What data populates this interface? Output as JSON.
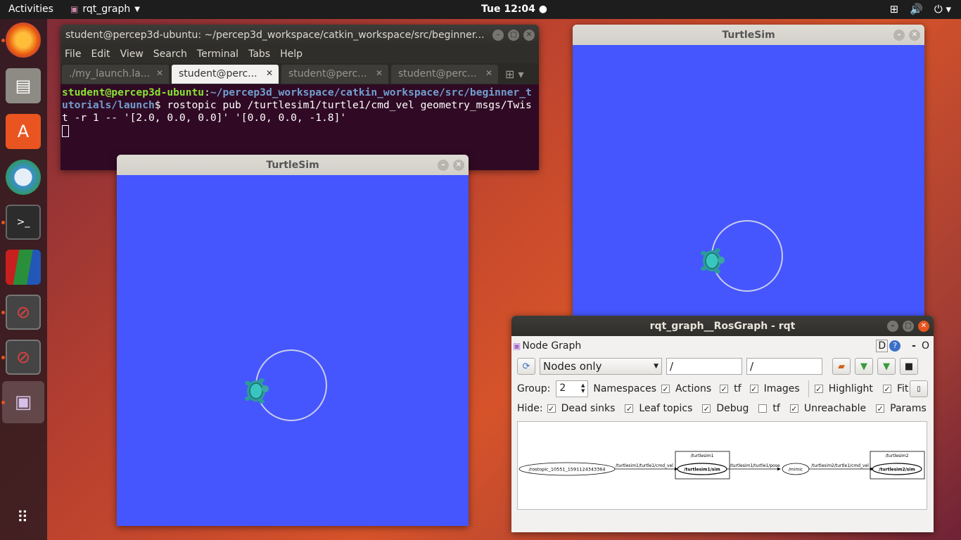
{
  "topbar": {
    "activities": "Activities",
    "app": "rqt_graph",
    "clock": "Tue 12:04 ●"
  },
  "dock": [
    "firefox-icon",
    "files-icon",
    "software-icon",
    "network-icon",
    "terminal-icon",
    "matlab-icon",
    "blocked-icon",
    "blocked-icon",
    "rqt-icon",
    "apps-grid-icon"
  ],
  "terminal": {
    "title": "student@percep3d-ubuntu: ~/percep3d_workspace/catkin_workspace/src/beginner...",
    "menu": [
      "File",
      "Edit",
      "View",
      "Search",
      "Terminal",
      "Tabs",
      "Help"
    ],
    "tabs": [
      "./my_launch.la...",
      "student@perc...",
      "student@perc...",
      "student@perc..."
    ],
    "prompt_user": "student@percep3d-ubuntu",
    "prompt_path": "~/percep3d_workspace/catkin_workspace/src/beginner_tutorials/launch",
    "command": "$ rostopic pub /turtlesim1/turtle1/cmd_vel geometry_msgs/Twist -r 1 -- '[2.0, 0.0, 0.0]' '[0.0, 0.0, -1.8]'"
  },
  "turtlesim1": {
    "title": "TurtleSim",
    "bg": "#4556ff"
  },
  "turtlesim2": {
    "title": "TurtleSim",
    "bg": "#4556ff"
  },
  "rqt": {
    "title": "rqt_graph__RosGraph - rqt",
    "plugin_title": "Node Graph",
    "plugin_ctrl": "D",
    "plugin_dash": "-",
    "plugin_o": "O",
    "mode": "Nodes only",
    "filter1": "/",
    "filter2": "/",
    "group_label": "Group:",
    "group_value": "2",
    "opts": [
      {
        "label": "Namespaces",
        "checked": true
      },
      {
        "label": "Actions",
        "checked": true
      },
      {
        "label": "tf",
        "checked": true
      },
      {
        "label": "Images",
        "checked": true
      },
      {
        "label": "Highlight",
        "checked": true
      },
      {
        "label": "Fit",
        "checked": true
      }
    ],
    "hide_label": "Hide:",
    "hide": [
      {
        "label": "Dead sinks",
        "checked": true
      },
      {
        "label": "Leaf topics",
        "checked": true
      },
      {
        "label": "Debug",
        "checked": true
      },
      {
        "label": "tf",
        "checked": false
      },
      {
        "label": "Unreachable",
        "checked": true
      },
      {
        "label": "Params",
        "checked": true
      }
    ],
    "graph": {
      "n_pub": "/rostopic_10551_1591124343364",
      "e1": "/turtlesim1/turtle1/cmd_vel",
      "ns1": "/turtlesim1",
      "n1": "/turtlesim1/sim",
      "e2": "/turtlesim1/turtle1/pose",
      "n_mimic": "/mimic",
      "e3": "/turtlesim2/turtle1/cmd_vel",
      "ns2": "/turtlesim2",
      "n2": "/turtlesim2/sim"
    }
  }
}
